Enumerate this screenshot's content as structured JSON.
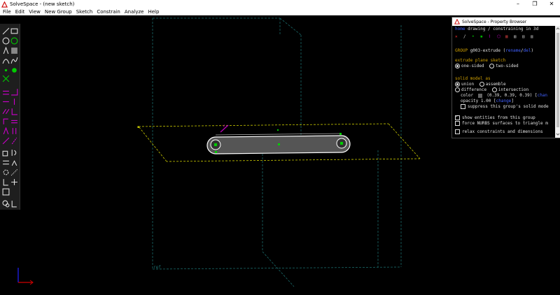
{
  "window": {
    "title": "SolveSpace - (new sketch)",
    "min": "–",
    "max": "❐",
    "close": "✕"
  },
  "menu": [
    "File",
    "Edit",
    "View",
    "New Group",
    "Sketch",
    "Constrain",
    "Analyze",
    "Help"
  ],
  "property_browser": {
    "title": "SolveSpace - Property Browser",
    "nav": {
      "home": "home",
      "sep": "  ",
      "mode": "drawing / constraining in 3d"
    },
    "group_label": "GROUP",
    "group_name": "g003-extrude",
    "rename": "rename",
    "del": "del",
    "extrude_heading": "extrude plane sketch",
    "one_sided": "one-sided",
    "two_sided": "two-sided",
    "solid_heading": "solid model as",
    "union": "union",
    "assemble": "assemble",
    "difference": "difference",
    "intersection": "intersection",
    "color_label": "color",
    "color_value": "(0.39, 0.39, 0.39)",
    "change": "chan",
    "opacity_label": "opacity",
    "opacity_value": "1.00",
    "opacity_change": "change",
    "suppress": "suppress this group's solid mode",
    "show_entities": "show entities from this group",
    "force_nurbs": "force NURBS surfaces to triangle m",
    "relax": "relax constraints and dimensions"
  },
  "viewport": {
    "ref_label": "ref",
    "colors": {
      "plane": "#c8c800",
      "ghost": "#1a6a6a",
      "axis_x": "#d00000",
      "axis_y": "#2020ff",
      "points": "#00cc00",
      "constraint": "#c000c0"
    }
  }
}
